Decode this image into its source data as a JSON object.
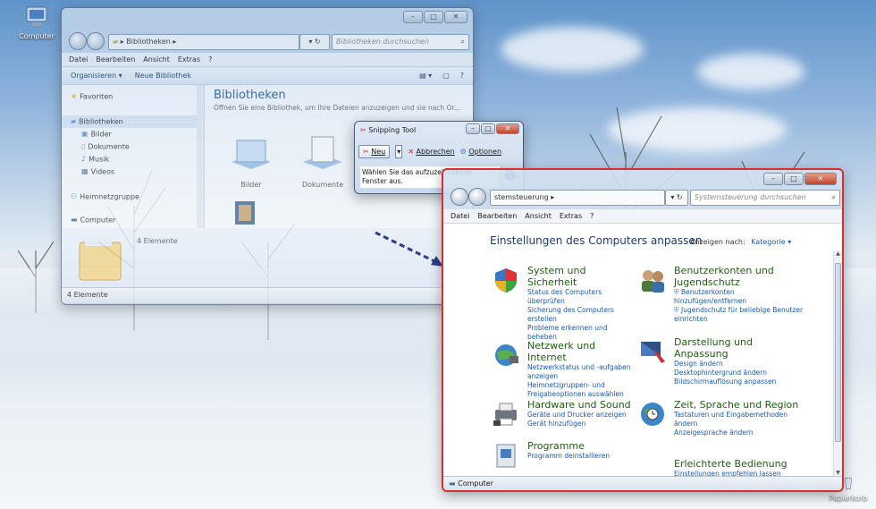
{
  "desktop": {
    "icons": [
      {
        "label": "Computer",
        "icon": "computer-icon"
      },
      {
        "label": "Papierkorb",
        "icon": "recycle-bin-icon"
      }
    ]
  },
  "explorer": {
    "breadcrumb": "Bibliotheken",
    "search_placeholder": "Bibliotheken durchsuchen",
    "menu": [
      "Datei",
      "Bearbeiten",
      "Ansicht",
      "Extras",
      "?"
    ],
    "toolbar": {
      "organize": "Organisieren ▾",
      "new_library": "Neue Bibliothek"
    },
    "nav": {
      "favorites": "Favoriten",
      "libraries": "Bibliotheken",
      "library_items": [
        "Bilder",
        "Dokumente",
        "Musik",
        "Videos"
      ],
      "homegroup": "Heimnetzgruppe",
      "computer": "Computer"
    },
    "heading": "Bibliotheken",
    "hint": "Öffnen Sie eine Bibliothek, um Ihre Dateien anzuzeigen und sie nach Or...",
    "library_tiles": [
      "Bilder",
      "Dokumente"
    ],
    "details_count": "4 Elemente",
    "status": "4 Elemente"
  },
  "snipping": {
    "title": "Snipping Tool",
    "new": "Neu",
    "cancel": "Abbrechen",
    "options": "Optionen",
    "message": "Wählen Sie das aufzuzeichnende Fenster aus."
  },
  "control_panel": {
    "breadcrumb": "stemsteuerung",
    "search_placeholder": "Systemsteuerung durchsuchen",
    "menu": [
      "Datei",
      "Bearbeiten",
      "Ansicht",
      "Extras",
      "?"
    ],
    "heading": "Einstellungen des Computers anpassen",
    "view_by_label": "Anzeigen nach:",
    "view_by_value": "Kategorie ▾",
    "status": "Computer",
    "categories": [
      {
        "icon": "shield-icon",
        "title": "System und Sicherheit",
        "links": [
          "Status des Computers überprüfen",
          "Sicherung des Computers erstellen",
          "Probleme erkennen und beheben"
        ]
      },
      {
        "icon": "users-icon",
        "title": "Benutzerkonten und Jugendschutz",
        "links": [
          "Benutzerkonten hinzufügen/entfernen",
          "Jugendschutz für beliebige Benutzer einrichten"
        ]
      },
      {
        "icon": "network-icon",
        "title": "Netzwerk und Internet",
        "links": [
          "Netzwerkstatus und -aufgaben anzeigen",
          "Heimnetzgruppen- und Freigabeoptionen auswählen"
        ]
      },
      {
        "icon": "display-icon",
        "title": "Darstellung und Anpassung",
        "links": [
          "Design ändern",
          "Desktophintergrund ändern",
          "Bildschirmauflösung anpassen"
        ]
      },
      {
        "icon": "printer-icon",
        "title": "Hardware und Sound",
        "links": [
          "Geräte und Drucker anzeigen",
          "Gerät hinzufügen"
        ]
      },
      {
        "icon": "clock-globe-icon",
        "title": "Zeit, Sprache und Region",
        "links": [
          "Tastaturen und Eingabemethoden ändern",
          "Anzeigesprache ändern"
        ]
      },
      {
        "icon": "programs-icon",
        "title": "Programme",
        "links": [
          "Programm deinstallieren"
        ]
      },
      {
        "icon": "ease-of-access-icon",
        "title": "Erleichterte Bedienung",
        "links": [
          "Einstellungen empfehlen lassen"
        ]
      }
    ]
  }
}
